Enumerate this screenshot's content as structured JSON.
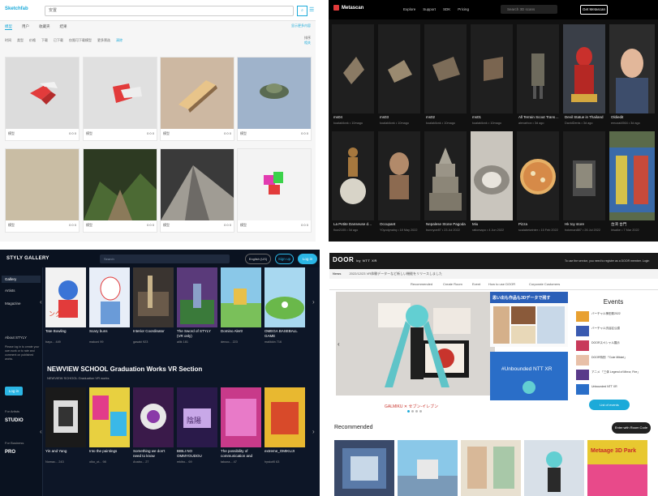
{
  "sketchfab": {
    "logo": "Sketchfab",
    "search_value": "安置",
    "search_button": "搜索",
    "tabs": [
      "模型",
      "用户",
      "收藏夹",
      "结果"
    ],
    "tab_right": "显示更多内容",
    "filters": [
      "时间",
      "类型",
      "价格",
      "下载",
      "已下载",
      "仅限可下载模型",
      "更多筛选",
      "清除"
    ],
    "sort_label": "排序",
    "sort_value": "相关",
    "cards": [
      {
        "meta": "模型",
        "stats": "0 0 0"
      },
      {
        "meta": "模型",
        "stats": "0 0 0"
      },
      {
        "meta": "模型",
        "stats": "0 0 0"
      },
      {
        "meta": "模型",
        "stats": "0 0 0"
      },
      {
        "meta": "模型",
        "stats": "0 0 0"
      },
      {
        "meta": "模型",
        "stats": "0 0 0"
      },
      {
        "meta": "模型",
        "stats": "0 0 0"
      },
      {
        "meta": "模型",
        "stats": "0 0 0"
      }
    ]
  },
  "metascan": {
    "brand": "Metascan",
    "nav": [
      "Explore",
      "Support",
      "SDK",
      "Pricing"
    ],
    "search_placeholder": "Search 3D scans",
    "get_button": "Get Metascan",
    "row1": [
      {
        "name": "ms04",
        "sub": "koalakilonk • 10mago"
      },
      {
        "name": "ms03",
        "sub": "koalakilonk • 10mago"
      },
      {
        "name": "ms02",
        "sub": "koalakilonk • 10mago"
      },
      {
        "name": "ms01",
        "sub": "koalakilonk • 10mago"
      },
      {
        "name": "All Terrain Scout Transport",
        "sub": "alexarbox • 3d ago"
      },
      {
        "name": "Devil Statue in Thailand",
        "sub": "DavidDenis • 3d ago"
      },
      {
        "name": "Oldiedit",
        "sub": "emozai4564 • 3d ago"
      }
    ],
    "row2": [
      {
        "name": "La Petite Danseuse de Quator...",
        "sub": "flow2105 • 3d ago"
      },
      {
        "name": "Occupant",
        "sub": "Y0yodynahq • 18 May 2022"
      },
      {
        "name": "Nepalese Stone Pagoda",
        "sub": "bunnyoe87 • 23 Jul 2022"
      },
      {
        "name": "Miu",
        "sub": "ratiorsapo • 4 Jun 2022"
      },
      {
        "name": "Pizza",
        "sub": "scalabeiwinter • 15 Feb 2022"
      },
      {
        "name": "Hk toy store",
        "sub": "hotzman887 • 26 Jul 2022"
      },
      {
        "name": "台湾 台門",
        "sub": "Irisaike • 7 Mar 2022"
      }
    ]
  },
  "styly": {
    "brand": "STYLY GALLERY",
    "search_placeholder": "Search",
    "language": "English (US)",
    "signup": "Sign up",
    "login": "Log in",
    "side_items": [
      "Gallery",
      "Artists",
      "Magazine"
    ],
    "about": "About STYLY",
    "about_text": "Please log in to create your own work or to rate and comment on published works.",
    "side_login": "Log in",
    "for_artists": "For Artists",
    "studio": "STUDIO",
    "for_business": "For Business",
    "pro": "PRO",
    "row1": [
      {
        "title": "Tate Bowling",
        "meta": "bayo... 449"
      },
      {
        "title": "Scary buns",
        "meta": "makoni 99"
      },
      {
        "title": "Interior Coordinator",
        "meta": "gasaki 923"
      },
      {
        "title": "The Sword of STYLY (VR only)",
        "meta": "ailik 181"
      },
      {
        "title": "Domino Alert!",
        "meta": "denco... 223"
      },
      {
        "title": "OMEGA BASEBALL GAME",
        "meta": "malikkin 716"
      }
    ],
    "section_title": "NEWVIEW SCHOOL Graduation Works VR Section",
    "section_sub": "NEWVIEW SCHOOL Graduation VR works",
    "row2": [
      {
        "title": "Yin and Yang",
        "meta": "Nomac... 243"
      },
      {
        "title": "Into the paintings",
        "meta": "olko_ot... 98"
      },
      {
        "title": "Something we don't need to know",
        "meta": "Anabo... 27"
      },
      {
        "title": "BIBLI NO OMMYOUDOU",
        "meta": "mkibo... 69"
      },
      {
        "title": "The possibility of communication and the...",
        "meta": "takuna... 47"
      },
      {
        "title": "extreme_OMIKUJI",
        "meta": "hyskof0 63"
      }
    ]
  },
  "door": {
    "brand": "DOOR",
    "brand_sub": "by NTT XR",
    "top_links": "To use the service, you need to register as a DOOR member.  Login",
    "news_label": "News",
    "news_text": "2022/12/23   VR体験データーなど新しい機能をリリースしました",
    "tabs": [
      "Recommended",
      "Create Room",
      "Event",
      "How to use DOOR",
      "Corporate Customers"
    ],
    "events_title": "Events",
    "events": [
      "バーチャル神田祭2022",
      "バーチャル渋谷区公認",
      "DOORスペシャル展示",
      "DOOR特別 「Cute Mikkel」",
      "アニメ 「三体 Legend of Mirror, Fire」",
      "Unbounded NTT XR"
    ],
    "list_button": "List of events",
    "promo_top": "思い出も作品も3Dデータで残す",
    "promo_bottom": "#Unbounded NTT XR",
    "hero_caption": "GALMIKU ✕ セブン-イレブン",
    "recommended": "Recommended",
    "enter_button": "Enter with Room Code",
    "rec_last": "Metaage 3D Park"
  },
  "colors": {
    "sketchfab_accent": "#1caad9",
    "styly_accent": "#2bb6e5",
    "door_accent": "#1caad9"
  }
}
